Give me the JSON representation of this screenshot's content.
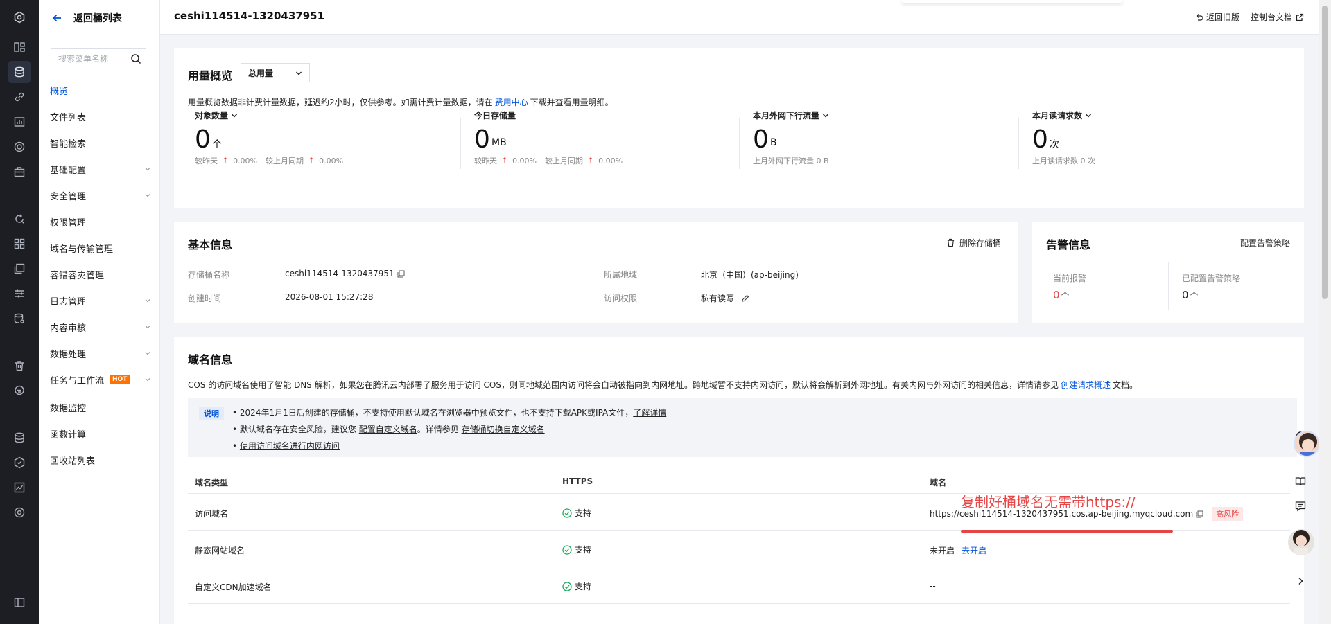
{
  "sidebar": {
    "back_label": "返回桶列表",
    "search_placeholder": "搜索菜单名称",
    "items": [
      {
        "label": "概览",
        "active": true,
        "has_children": false
      },
      {
        "label": "文件列表",
        "has_children": false
      },
      {
        "label": "智能检索",
        "has_children": false
      },
      {
        "label": "基础配置",
        "has_children": true
      },
      {
        "label": "安全管理",
        "has_children": true
      },
      {
        "label": "权限管理",
        "has_children": false
      },
      {
        "label": "域名与传输管理",
        "has_children": false
      },
      {
        "label": "容错容灾管理",
        "has_children": false
      },
      {
        "label": "日志管理",
        "has_children": true
      },
      {
        "label": "内容审核",
        "has_children": true
      },
      {
        "label": "数据处理",
        "has_children": true
      },
      {
        "label": "任务与工作流",
        "has_children": true,
        "badge": "HOT"
      },
      {
        "label": "数据监控",
        "has_children": false
      },
      {
        "label": "函数计算",
        "has_children": false
      },
      {
        "label": "回收站列表",
        "has_children": false
      }
    ]
  },
  "header": {
    "title": "ceshi114514-1320437951",
    "old_version": "返回旧版",
    "console_docs": "控制台文档"
  },
  "usage": {
    "title": "用量概览",
    "select_value": "总用量",
    "note_prefix": "用量概览数据非计费计量数据，延迟约2小时，仅供参考。如需计费计量数据，请在",
    "note_link": "费用中心",
    "note_suffix": "下载并查看用量明细。",
    "stats": [
      {
        "label": "对象数量",
        "value": "0",
        "unit": "个",
        "day_label": "较昨天",
        "day_value": "0.00%",
        "month_label": "较上月同期",
        "month_value": "0.00%"
      },
      {
        "label": "今日存储量",
        "value": "0",
        "unit": "MB",
        "day_label": "较昨天",
        "day_value": "0.00%",
        "month_label": "较上月同期",
        "month_value": "0.00%"
      },
      {
        "label": "本月外网下行流量",
        "value": "0",
        "unit": "B",
        "sub": "上月外网下行流量 0 B"
      },
      {
        "label": "本月读请求数",
        "value": "0",
        "unit": "次",
        "sub": "上月读请求数 0 次"
      }
    ]
  },
  "basic": {
    "title": "基本信息",
    "delete_label": "删除存储桶",
    "bucket_name_label": "存储桶名称",
    "bucket_name": "ceshi114514-1320437951",
    "created_label": "创建时间",
    "created": "2026-08-01 15:27:28",
    "region_label": "所属地域",
    "region": "北京（中国）(ap-beijing)",
    "access_label": "访问权限",
    "access": "私有读写"
  },
  "alert": {
    "title": "告警信息",
    "config_link": "配置告警策略",
    "current_label": "当前报警",
    "current_value": "0",
    "current_unit": "个",
    "configured_label": "已配置告警策略",
    "configured_value": "0",
    "configured_unit": "个"
  },
  "domain": {
    "title": "域名信息",
    "desc_prefix": "COS 的访问域名使用了智能 DNS 解析，如果您在腾讯云内部署了服务用于访问 COS，则同地域范围内访问将会自动被指向到内网地址。跨地域暂不支持内网访问，默认将会解析到外网地址。有关内网与外网访问的相关信息，详情请参见",
    "desc_link": "创建请求概述",
    "desc_suffix": "文档。",
    "notice_tag": "说明",
    "notice1": "2024年1月1日后创建的存储桶，不支持使用默认域名在浏览器中预览文件，也不支持下载APK或IPA文件，",
    "notice1_link": "了解详情",
    "notice2_prefix": "默认域名存在安全风险，建议您",
    "notice2_link1": "配置自定义域名",
    "notice2_mid": "。详情参见",
    "notice2_link2": "存储桶切换自定义域名",
    "notice3_link": "使用访问域名进行内网访问",
    "col_type": "域名类型",
    "col_https": "HTTPS",
    "col_domain": "域名",
    "rows": [
      {
        "type": "访问域名",
        "https": "支持",
        "domain": "https://ceshi114514-1320437951.cos.ap-beijing.myqcloud.com",
        "risk": "高风险"
      },
      {
        "type": "静态网站域名",
        "https": "支持",
        "domain": "未开启",
        "action": "去开启"
      },
      {
        "type": "自定义CDN加速域名",
        "https": "支持",
        "domain": "--"
      }
    ],
    "annotation": "复制好桶域名无需带https://"
  },
  "colors": {
    "primary": "#0052d9",
    "danger": "#e54545",
    "rail": "#1c1e24"
  }
}
